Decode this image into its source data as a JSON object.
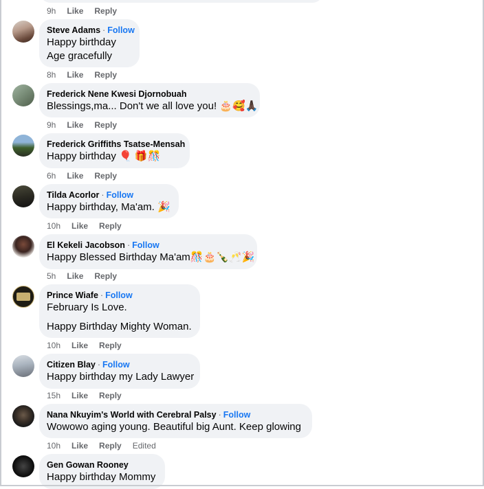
{
  "actions": {
    "like": "Like",
    "reply": "Reply",
    "follow": "Follow",
    "edited": "Edited",
    "separator": "·"
  },
  "top_partial": {
    "time": "9h"
  },
  "comments": [
    {
      "author": "Steve Adams",
      "follow": true,
      "lines": [
        "Happy birthday",
        "Age gracefully"
      ],
      "time": "8h"
    },
    {
      "author": "Frederick Nene Kwesi Djornobuah",
      "follow": false,
      "lines": [
        "Blessings,ma... Don't we all love you! 🎂🥰🙏🏿"
      ],
      "time": "9h"
    },
    {
      "author": "Frederick Griffiths Tsatse-Mensah",
      "follow": false,
      "lines": [
        "Happy birthday 🎈 🎁🎊"
      ],
      "time": "6h"
    },
    {
      "author": "Tilda Acorlor",
      "follow": true,
      "lines": [
        "Happy birthday, Ma'am. 🎉"
      ],
      "time": "10h"
    },
    {
      "author": "El Kekeli Jacobson",
      "follow": true,
      "lines": [
        "Happy Blessed Birthday Ma'am🎊🎂🍾🥂🎉"
      ],
      "time": "5h"
    },
    {
      "author": "Prince Wiafe",
      "follow": true,
      "lines": [
        "February Is Love.",
        "Happy Birthday Mighty Woman."
      ],
      "time": "10h"
    },
    {
      "author": "Citizen Blay",
      "follow": true,
      "lines": [
        "Happy birthday my Lady Lawyer"
      ],
      "time": "15h"
    },
    {
      "author": "Nana Nkuyim's World with Cerebral Palsy",
      "follow": true,
      "lines": [
        "Wowowo aging young. Beautiful big Aunt. Keep glowing"
      ],
      "time": "10h",
      "edited": true
    },
    {
      "author": "Gen Gowan Rooney",
      "follow": false,
      "lines": [
        "Happy birthday Mommy"
      ]
    }
  ],
  "colors": {
    "bubble": "#f0f2f5",
    "follow": "#1877f2",
    "meta": "#65676b",
    "text": "#050505"
  }
}
